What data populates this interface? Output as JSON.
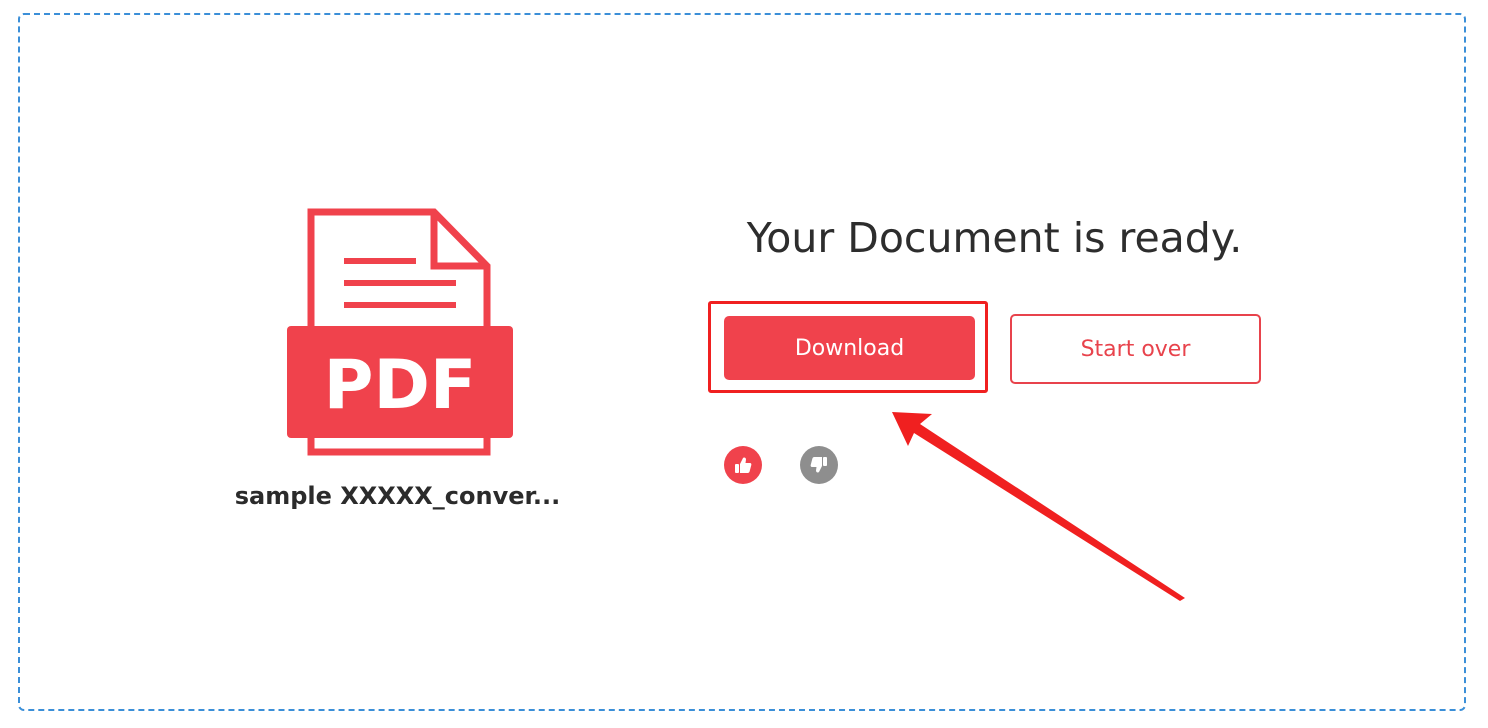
{
  "file": {
    "name": "sample XXXXX_conver...",
    "badge": "PDF"
  },
  "result": {
    "headline": "Your Document is ready."
  },
  "actions": {
    "download_label": "Download",
    "start_over_label": "Start over"
  },
  "feedback": {
    "like_icon": "thumbs-up-icon",
    "dislike_icon": "thumbs-down-icon"
  },
  "colors": {
    "accent": "#f0424c",
    "frame_border": "#3b8fd8",
    "annotation": "#f02020",
    "neutral": "#8e8e8e"
  }
}
